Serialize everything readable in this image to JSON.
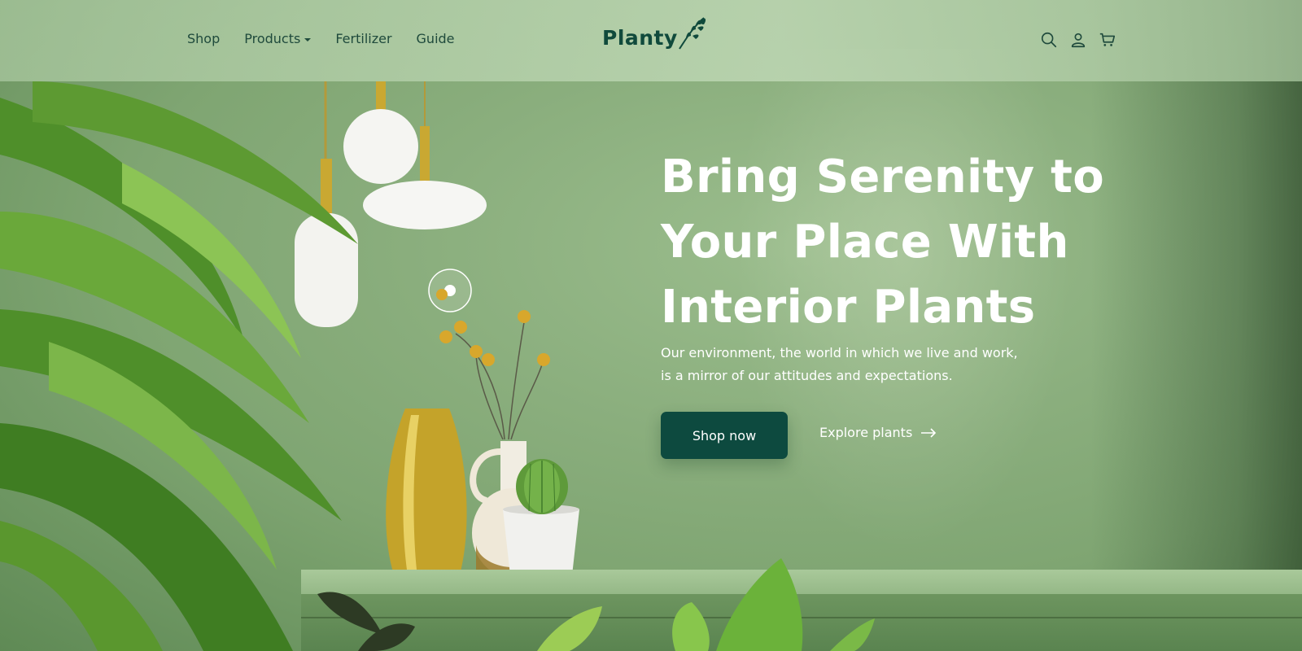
{
  "nav": {
    "items": [
      {
        "label": "Shop"
      },
      {
        "label": "Products",
        "has_dropdown": true
      },
      {
        "label": "Fertilizer"
      },
      {
        "label": "Guide"
      }
    ]
  },
  "logo": {
    "text": "Planty"
  },
  "header_icons": [
    "search-icon",
    "user-icon",
    "cart-icon"
  ],
  "hero": {
    "title": "Bring Serenity to Your Place With Interior Plants",
    "subtitle": "Our environment, the world in which we live and work, is a mirror of our attitudes and expectations.",
    "primary_button": "Shop now",
    "secondary_link": "Explore plants"
  },
  "colors": {
    "brand": "#0d4a3f",
    "nav_text": "#1f4a3c",
    "hero_text": "#ffffff",
    "background": "#8aae7d"
  }
}
